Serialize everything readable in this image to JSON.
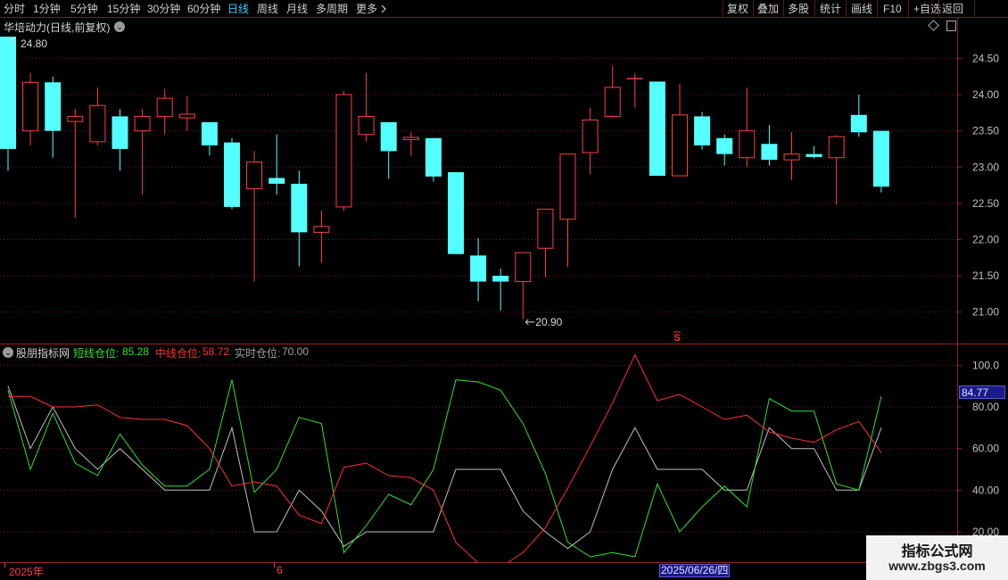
{
  "toolbar": {
    "left_items": [
      "分时",
      "1分钟",
      "5分钟",
      "15分钟",
      "30分钟",
      "60分钟",
      "日线",
      "周线",
      "月线",
      "多周期",
      "更多"
    ],
    "active_item": "日线",
    "right_items": [
      "复权",
      "叠加",
      "多股",
      "统计",
      "画线",
      "F10",
      "+自选",
      "返回"
    ],
    "more_icon": "chevron-right-icon"
  },
  "main_chart": {
    "title": "华培动力(日线,前复权)",
    "high_marker": "24.80",
    "low_marker": "20.90",
    "y_ticks": [
      "24.50",
      "24.00",
      "23.50",
      "23.00",
      "22.50",
      "22.00",
      "21.50",
      "21.00"
    ],
    "signal_mark": "S",
    "colors": {
      "up": "#ff4040",
      "down": "#54ffff",
      "grid": "#7a1c1c"
    }
  },
  "indicator": {
    "name": "股朋指标网",
    "short_label": "短线仓位:",
    "short_value": "85.28",
    "mid_label": "中线仓位:",
    "mid_value": "58.72",
    "real_label": "实时仓位:",
    "real_value": "70.00",
    "y_ticks": [
      "100.0",
      "80.00",
      "60.00",
      "40.00",
      "20.00"
    ],
    "current_value": "84.77",
    "colors": {
      "short": "#30e030",
      "mid": "#ff3030",
      "real": "#c0c0c0"
    }
  },
  "bottom_axis": {
    "year_label": "2025年",
    "month_label": "6",
    "cursor_date": "2025/06/26/四"
  },
  "watermark": {
    "title": "指标公式网",
    "url": "www.zbgs3.com"
  },
  "chart_data": [
    {
      "type": "candlestick",
      "title": "华培动力(日线,前复权)",
      "ylim": [
        20.75,
        24.85
      ],
      "candles": [
        {
          "o": 24.8,
          "c": 23.25,
          "h": 24.8,
          "l": 22.95
        },
        {
          "o": 23.5,
          "c": 24.17,
          "h": 24.3,
          "l": 23.3
        },
        {
          "o": 24.17,
          "c": 23.5,
          "h": 24.25,
          "l": 23.13
        },
        {
          "o": 23.63,
          "c": 23.7,
          "h": 23.8,
          "l": 22.3
        },
        {
          "o": 23.35,
          "c": 23.85,
          "h": 24.1,
          "l": 23.3
        },
        {
          "o": 23.7,
          "c": 23.25,
          "h": 23.8,
          "l": 22.95
        },
        {
          "o": 23.5,
          "c": 23.7,
          "h": 23.8,
          "l": 22.62
        },
        {
          "o": 23.7,
          "c": 23.95,
          "h": 24.08,
          "l": 23.45
        },
        {
          "o": 23.68,
          "c": 23.73,
          "h": 23.98,
          "l": 23.5
        },
        {
          "o": 23.62,
          "c": 23.3,
          "h": 23.62,
          "l": 23.16
        },
        {
          "o": 23.34,
          "c": 22.45,
          "h": 23.4,
          "l": 22.42
        },
        {
          "o": 22.7,
          "c": 23.07,
          "h": 23.22,
          "l": 21.42
        },
        {
          "o": 22.85,
          "c": 22.77,
          "h": 23.45,
          "l": 22.62
        },
        {
          "o": 22.77,
          "c": 22.1,
          "h": 22.95,
          "l": 21.63
        },
        {
          "o": 22.1,
          "c": 22.18,
          "h": 22.4,
          "l": 21.68
        },
        {
          "o": 22.45,
          "c": 24.0,
          "h": 24.05,
          "l": 22.4
        },
        {
          "o": 23.45,
          "c": 23.7,
          "h": 24.3,
          "l": 23.35
        },
        {
          "o": 23.62,
          "c": 23.22,
          "h": 23.62,
          "l": 22.84
        },
        {
          "o": 23.38,
          "c": 23.41,
          "h": 23.48,
          "l": 23.15
        },
        {
          "o": 23.4,
          "c": 22.87,
          "h": 23.4,
          "l": 22.8
        },
        {
          "o": 22.93,
          "c": 21.8,
          "h": 22.93,
          "l": 21.8
        },
        {
          "o": 21.78,
          "c": 21.42,
          "h": 22.02,
          "l": 21.15
        },
        {
          "o": 21.5,
          "c": 21.42,
          "h": 21.6,
          "l": 21.02
        },
        {
          "o": 21.42,
          "c": 21.82,
          "h": 21.82,
          "l": 20.9
        },
        {
          "o": 21.88,
          "c": 22.42,
          "h": 22.42,
          "l": 21.48
        },
        {
          "o": 22.28,
          "c": 23.18,
          "h": 23.18,
          "l": 21.62
        },
        {
          "o": 23.2,
          "c": 23.65,
          "h": 23.82,
          "l": 22.9
        },
        {
          "o": 23.7,
          "c": 24.1,
          "h": 24.4,
          "l": 23.68
        },
        {
          "o": 24.22,
          "c": 24.22,
          "h": 24.3,
          "l": 23.82
        },
        {
          "o": 24.18,
          "c": 22.88,
          "h": 24.18,
          "l": 22.88
        },
        {
          "o": 22.88,
          "c": 23.72,
          "h": 24.15,
          "l": 22.88
        },
        {
          "o": 23.7,
          "c": 23.3,
          "h": 23.76,
          "l": 23.24
        },
        {
          "o": 23.4,
          "c": 23.18,
          "h": 23.45,
          "l": 23.02
        },
        {
          "o": 23.13,
          "c": 23.5,
          "h": 24.1,
          "l": 23.0
        },
        {
          "o": 23.32,
          "c": 23.1,
          "h": 23.58,
          "l": 23.02
        },
        {
          "o": 23.1,
          "c": 23.18,
          "h": 23.48,
          "l": 22.82
        },
        {
          "o": 23.18,
          "c": 23.14,
          "h": 23.29,
          "l": 23.12
        },
        {
          "o": 23.13,
          "c": 23.42,
          "h": 23.44,
          "l": 22.48
        },
        {
          "o": 23.72,
          "c": 23.48,
          "h": 24.0,
          "l": 23.42
        },
        {
          "o": 23.5,
          "c": 22.73,
          "h": 23.5,
          "l": 22.65
        }
      ]
    },
    {
      "type": "line",
      "ylim": [
        5,
        110
      ],
      "x": [
        0,
        1,
        2,
        3,
        4,
        5,
        6,
        7,
        8,
        9,
        10,
        11,
        12,
        13,
        14,
        15,
        16,
        17,
        18,
        19,
        20,
        21,
        22,
        23,
        24,
        25,
        26,
        27,
        28,
        29,
        30,
        31,
        32,
        33,
        34,
        35,
        36,
        37,
        38,
        39
      ],
      "series": [
        {
          "name": "短线仓位",
          "values": [
            88,
            50,
            77,
            53,
            47,
            67,
            52,
            42,
            42,
            50,
            93,
            39,
            50,
            75,
            72,
            10,
            23,
            38,
            33,
            50,
            93,
            92,
            88,
            72,
            48,
            15,
            8,
            10,
            8,
            43,
            20,
            32,
            42,
            32,
            84,
            78,
            78,
            43,
            40,
            85
          ]
        },
        {
          "name": "中线仓位",
          "values": [
            85,
            85,
            80,
            80,
            81,
            75,
            74,
            74,
            71,
            60,
            42,
            44,
            42,
            28,
            24,
            51,
            53,
            47,
            46,
            40,
            15,
            5,
            3,
            10,
            22,
            41,
            61,
            82,
            105,
            83,
            86,
            80,
            74,
            76,
            68,
            65,
            63,
            69,
            73,
            58
          ]
        },
        {
          "name": "实时仓位",
          "values": [
            90,
            60,
            80,
            60,
            50,
            60,
            50,
            40,
            40,
            40,
            70,
            20,
            20,
            40,
            30,
            13,
            20,
            20,
            20,
            20,
            50,
            50,
            50,
            30,
            20,
            12,
            20,
            50,
            70,
            50,
            50,
            50,
            40,
            40,
            70,
            60,
            60,
            40,
            40,
            70
          ]
        }
      ]
    }
  ]
}
